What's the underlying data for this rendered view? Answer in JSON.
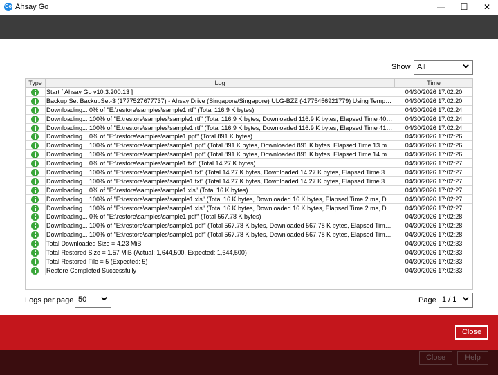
{
  "window": {
    "title": "Ahsay Go",
    "app_icon_text": "Go",
    "minimize": "—",
    "maximize": "☐",
    "close": "✕"
  },
  "show": {
    "label": "Show",
    "value": "All"
  },
  "table": {
    "headers": {
      "type": "Type",
      "log": "Log",
      "time": "Time"
    },
    "rows": [
      {
        "type": "info-icon",
        "log": "Start [ Ahsay Go v10.3.200.13 ]",
        "time": "04/30/2026 17:02:20"
      },
      {
        "type": "info-icon",
        "log": "Backup Set BackupSet-3 (1777527677737) - Ahsay Drive (Singapore/Singapore) ULG-BZZ (-1775456921779) Using Temporary Folder ...",
        "time": "04/30/2026 17:02:20"
      },
      {
        "type": "info-icon",
        "log": "Downloading... 0% of \"E:\\restore\\samples\\sample1.rtf\" (Total 116.9 K bytes)",
        "time": "04/30/2026 17:02:24"
      },
      {
        "type": "info-icon",
        "log": "Downloading... 100% of \"E:\\restore\\samples\\sample1.rtf\" (Total 116.9 K bytes, Downloaded 116.9 K bytes, Elapsed Time 40 ms...",
        "time": "04/30/2026 17:02:24"
      },
      {
        "type": "info-icon",
        "log": "Downloading... 100% of \"E:\\restore\\samples\\sample1.rtf\" (Total 116.9 K bytes, Downloaded 116.9 K bytes, Elapsed Time 41 ms...",
        "time": "04/30/2026 17:02:24"
      },
      {
        "type": "info-icon",
        "log": "Downloading... 0% of \"E:\\restore\\samples\\sample1.ppt\" (Total 891 K bytes)",
        "time": "04/30/2026 17:02:26"
      },
      {
        "type": "info-icon",
        "log": "Downloading... 100% of \"E:\\restore\\samples\\sample1.ppt\" (Total 891 K bytes, Downloaded 891 K bytes, Elapsed Time 13 ms, ...",
        "time": "04/30/2026 17:02:26"
      },
      {
        "type": "info-icon",
        "log": "Downloading... 100% of \"E:\\restore\\samples\\sample1.ppt\" (Total 891 K bytes, Downloaded 891 K bytes, Elapsed Time 14 ms, ...",
        "time": "04/30/2026 17:02:26"
      },
      {
        "type": "info-icon",
        "log": "Downloading... 0% of \"E:\\restore\\samples\\sample1.txt\" (Total 14.27 K bytes)",
        "time": "04/30/2026 17:02:27"
      },
      {
        "type": "info-icon",
        "log": "Downloading... 100% of \"E:\\restore\\samples\\sample1.txt\" (Total 14.27 K bytes, Downloaded 14.27 K bytes, Elapsed Time 3 ms...",
        "time": "04/30/2026 17:02:27"
      },
      {
        "type": "info-icon",
        "log": "Downloading... 100% of \"E:\\restore\\samples\\sample1.txt\" (Total 14.27 K bytes, Downloaded 14.27 K bytes, Elapsed Time 3 ms...",
        "time": "04/30/2026 17:02:27"
      },
      {
        "type": "info-icon",
        "log": "Downloading... 0% of \"E:\\restore\\samples\\sample1.xls\" (Total 16 K bytes)",
        "time": "04/30/2026 17:02:27"
      },
      {
        "type": "info-icon",
        "log": "Downloading... 100% of \"E:\\restore\\samples\\sample1.xls\" (Total 16 K bytes, Downloaded 16 K bytes, Elapsed Time 2 ms, Dow...",
        "time": "04/30/2026 17:02:27"
      },
      {
        "type": "info-icon",
        "log": "Downloading... 100% of \"E:\\restore\\samples\\sample1.xls\" (Total 16 K bytes, Downloaded 16 K bytes, Elapsed Time 2 ms, Dow...",
        "time": "04/30/2026 17:02:27"
      },
      {
        "type": "info-icon",
        "log": "Downloading... 0% of \"E:\\restore\\samples\\sample1.pdf\" (Total 567.78 K bytes)",
        "time": "04/30/2026 17:02:28"
      },
      {
        "type": "info-icon",
        "log": "Downloading... 100% of \"E:\\restore\\samples\\sample1.pdf\" (Total 567.78 K bytes, Downloaded 567.78 K bytes, Elapsed Time 8...",
        "time": "04/30/2026 17:02:28"
      },
      {
        "type": "info-icon",
        "log": "Downloading... 100% of \"E:\\restore\\samples\\sample1.pdf\" (Total 567.78 K bytes, Downloaded 567.78 K bytes, Elapsed Time 9...",
        "time": "04/30/2026 17:02:28"
      },
      {
        "type": "info-icon",
        "log": "Total Downloaded Size = 4.23 MiB",
        "time": "04/30/2026 17:02:33"
      },
      {
        "type": "info-icon",
        "log": "Total Restored Size = 1.57 MiB (Actual: 1,644,500, Expected: 1,644,500)",
        "time": "04/30/2026 17:02:33"
      },
      {
        "type": "info-icon",
        "log": "Total Restored File = 5 (Expected: 5)",
        "time": "04/30/2026 17:02:33"
      },
      {
        "type": "info-icon",
        "log": "Restore Completed Successfully",
        "time": "04/30/2026 17:02:33"
      }
    ]
  },
  "logs_per_page": {
    "label": "Logs per page",
    "value": "50"
  },
  "page": {
    "label": "Page",
    "value": "1 / 1"
  },
  "footer": {
    "close_label": "Close",
    "ghost_close_label": "Close",
    "help_label": "Help"
  },
  "colors": {
    "accent_red": "#c4161c",
    "info_green": "#3aa63a"
  }
}
